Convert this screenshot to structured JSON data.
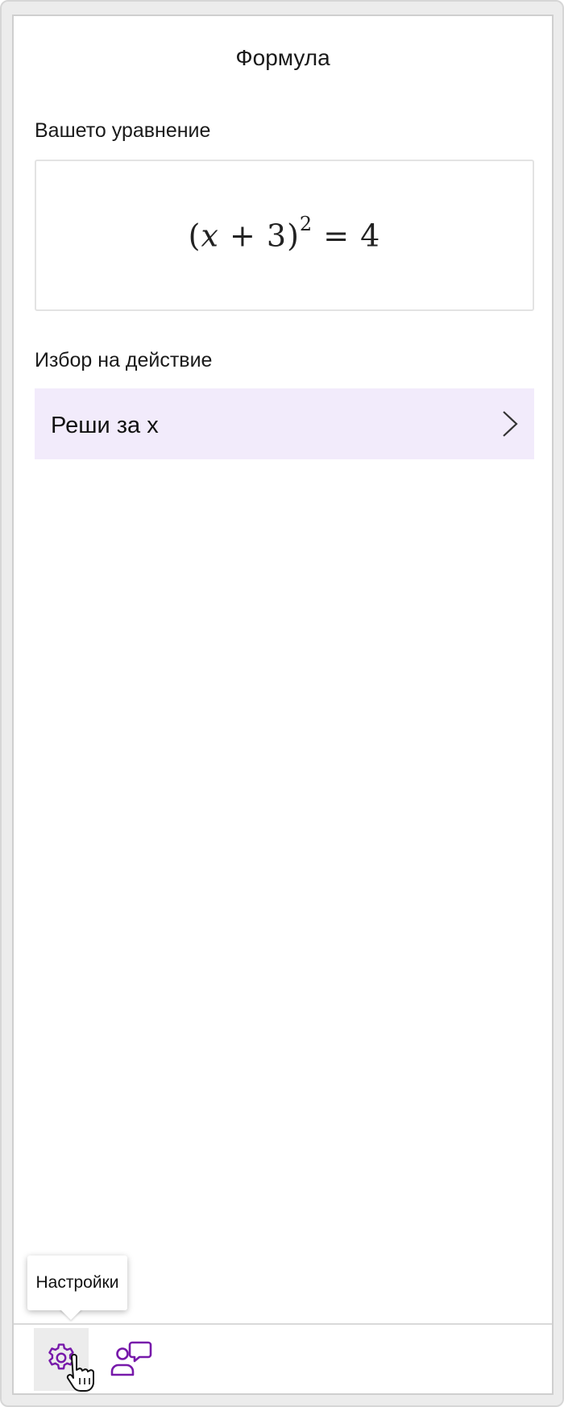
{
  "header": {
    "title": "Формула"
  },
  "equation": {
    "section_label": "Вашето уравнение",
    "lhs_open": "(",
    "variable": "x",
    "plus": " + 3",
    "lhs_close": ")",
    "exponent": "2",
    "rhs": " = 4"
  },
  "actions": {
    "section_label": "Избор на действие",
    "items": [
      {
        "label": "Реши за x"
      }
    ]
  },
  "toolbar": {
    "tooltip": "Настройки",
    "settings_icon": "gear-icon",
    "feedback_icon": "feedback-icon"
  },
  "colors": {
    "accent": "#7719aa",
    "action_bg": "#f2ebfb"
  }
}
